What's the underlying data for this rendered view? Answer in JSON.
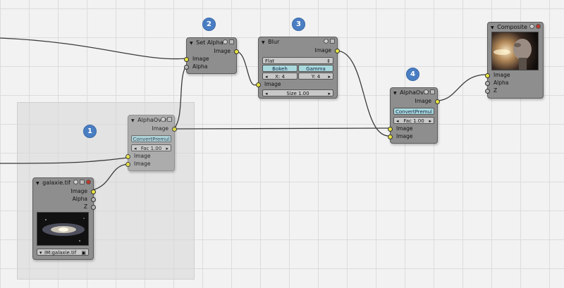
{
  "badges": [
    "1",
    "2",
    "3",
    "4"
  ],
  "set_alpha": {
    "title": "Set Alpha",
    "out_image": "Image",
    "in_image": "Image",
    "in_alpha": "Alpha"
  },
  "blur": {
    "title": "Blur",
    "out_image": "Image",
    "filter": "Flat",
    "bokeh": "Bokeh",
    "gamma": "Gamma",
    "x_field": "X: 4",
    "y_field": "Y: 4",
    "in_image": "Image",
    "size_field": "Size 1.00"
  },
  "alphaover_right": {
    "title": "AlphaOver",
    "out_image": "Image",
    "convert": "ConvertPremul",
    "fac": "Fac 1.00",
    "in_image1": "Image",
    "in_image2": "Image"
  },
  "alphaover_left": {
    "title": "AlphaOver",
    "out_image": "Image",
    "convert": "ConvertPremul",
    "fac": "Fac 1.00",
    "in_image1": "Image",
    "in_image2": "Image"
  },
  "composite": {
    "title": "Composite",
    "in_image": "Image",
    "in_alpha": "Alpha",
    "in_z": "Z"
  },
  "galaxie": {
    "title": "galaxie.tif",
    "out_image": "Image",
    "out_alpha": "Alpha",
    "out_z": "Z",
    "image_field": "IM:galaxie.tif"
  },
  "colors": {
    "socket_color": "#e8e340",
    "badge_color": "#4a7ec3",
    "convert_button": "#a9d9dd"
  }
}
